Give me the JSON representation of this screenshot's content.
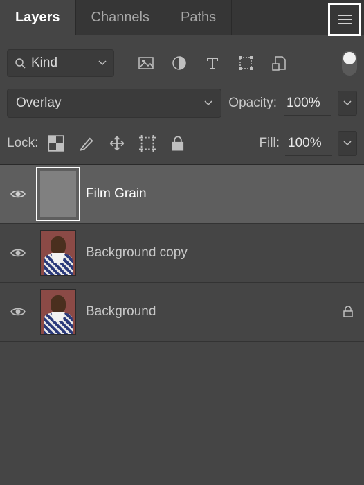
{
  "tabs": {
    "layers": "Layers",
    "channels": "Channels",
    "paths": "Paths",
    "active": "layers"
  },
  "filter": {
    "kind_label": "Kind"
  },
  "blend": {
    "mode": "Overlay",
    "opacity_label": "Opacity:",
    "opacity_value": "100%"
  },
  "lock": {
    "label": "Lock:",
    "fill_label": "Fill:",
    "fill_value": "100%"
  },
  "layers": [
    {
      "name": "Film Grain",
      "visible": true,
      "selected": true,
      "locked": false,
      "thumb": "solid"
    },
    {
      "name": "Background copy",
      "visible": true,
      "selected": false,
      "locked": false,
      "thumb": "photo"
    },
    {
      "name": "Background",
      "visible": true,
      "selected": false,
      "locked": true,
      "thumb": "photo"
    }
  ]
}
